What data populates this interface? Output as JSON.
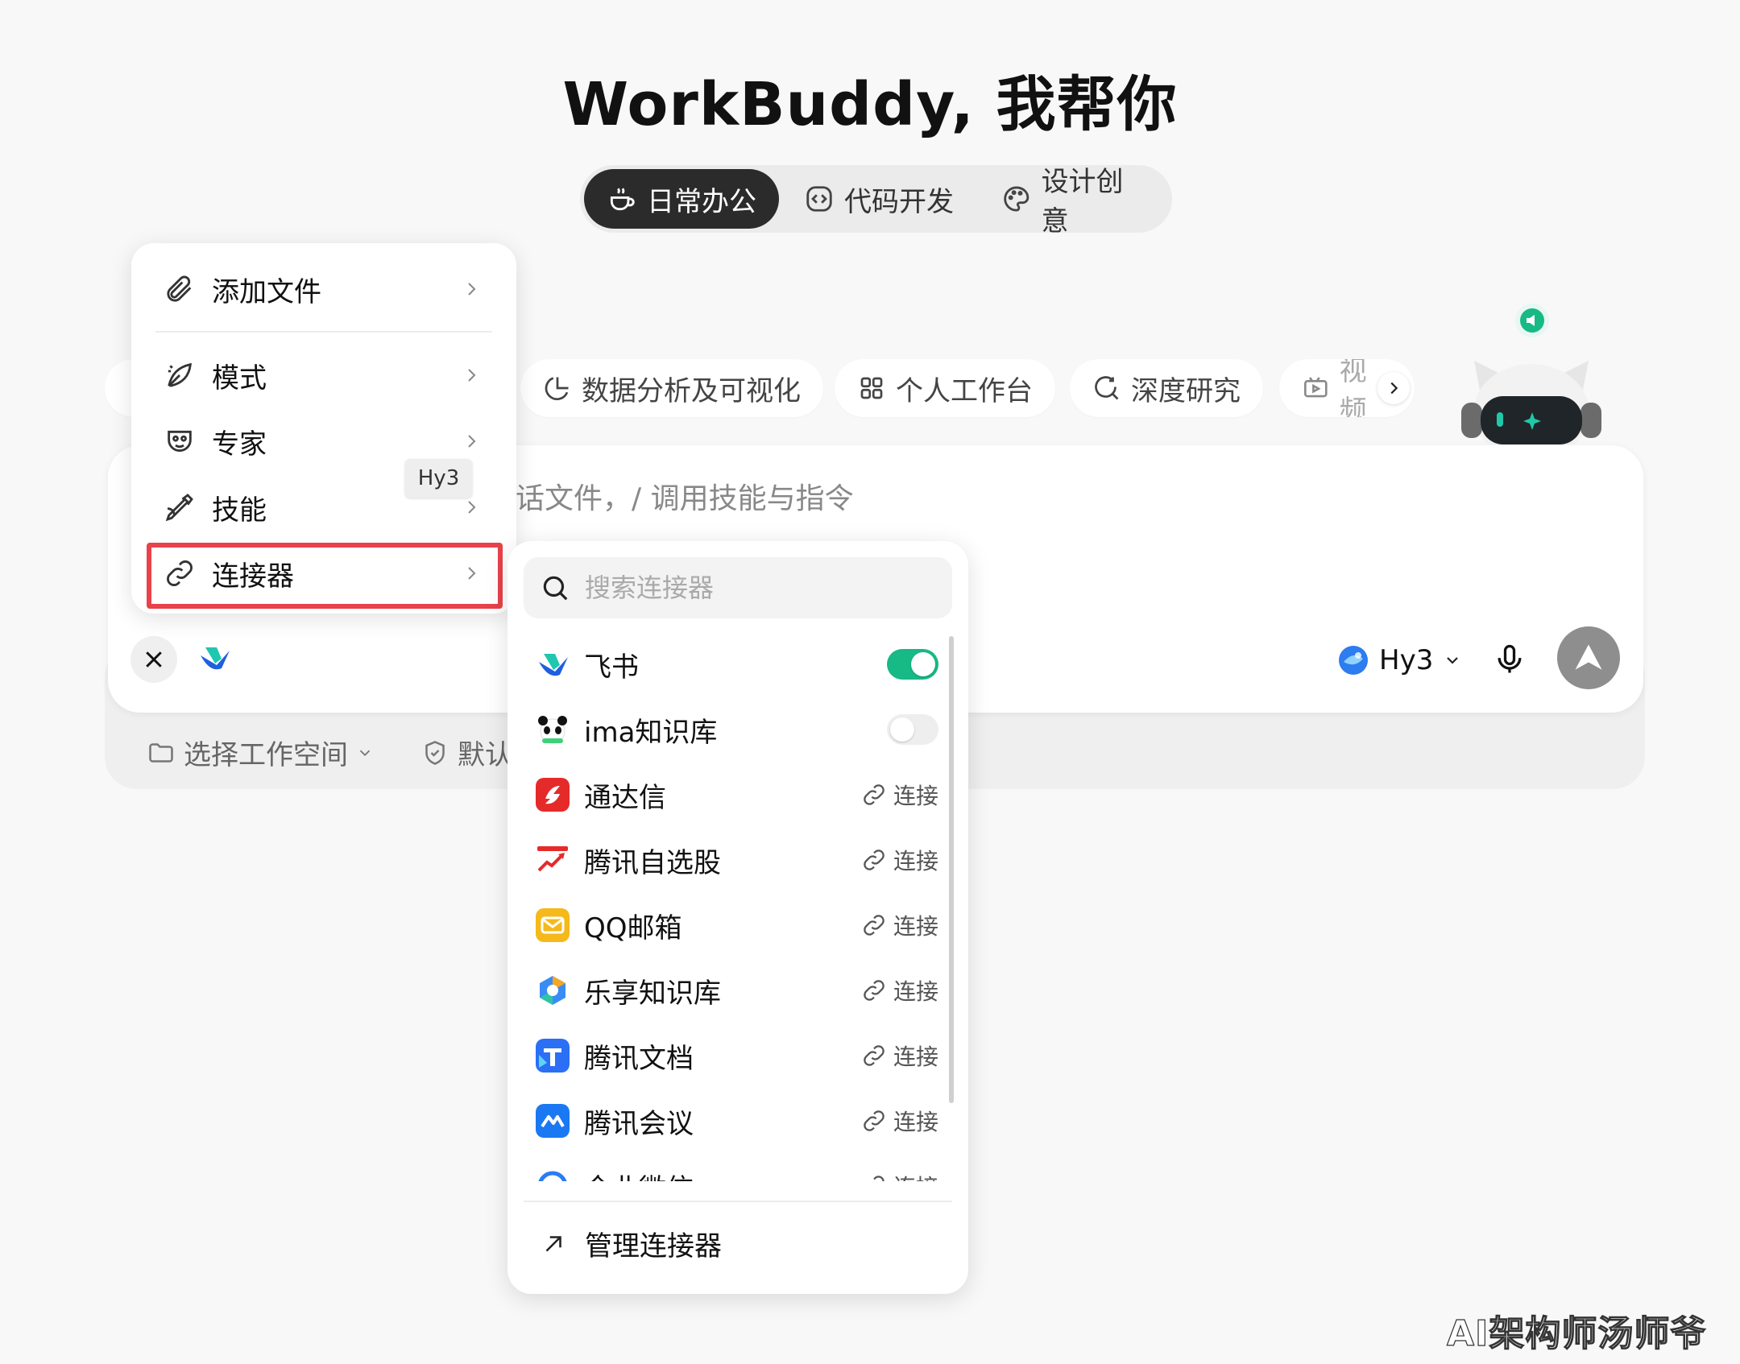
{
  "title": "WorkBuddy, 我帮你",
  "mode_tabs": [
    {
      "label": "日常办公",
      "icon": "coffee-icon",
      "active": true
    },
    {
      "label": "代码开发",
      "icon": "code-icon",
      "active": false
    },
    {
      "label": "设计创意",
      "icon": "palette-icon",
      "active": false
    }
  ],
  "chips": [
    {
      "label": "数据分析及可视化",
      "icon": "pie-chart-icon"
    },
    {
      "label": "个人工作台",
      "icon": "grid-icon"
    },
    {
      "label": "深度研究",
      "icon": "search-refresh-icon"
    },
    {
      "label": "视频",
      "icon": "video-icon"
    }
  ],
  "input": {
    "placeholder": "话文件，/ 调用技能与指令"
  },
  "left_menu": [
    {
      "label": "添加文件",
      "icon": "paperclip-icon"
    },
    {
      "label": "模式",
      "icon": "leaf-icon"
    },
    {
      "label": "专家",
      "icon": "mask-icon"
    },
    {
      "label": "技能",
      "icon": "pen-icon"
    },
    {
      "label": "连接器",
      "icon": "link-icon"
    }
  ],
  "tooltip": "Hy3",
  "model": {
    "label": "Hy3"
  },
  "toolbar": {
    "workspace_label": "选择工作空间",
    "default_label": "默认"
  },
  "connector_panel": {
    "search_placeholder": "搜索连接器",
    "items": [
      {
        "name": "飞书",
        "state": "on"
      },
      {
        "name": "ima知识库",
        "state": "off"
      },
      {
        "name": "通达信",
        "state": "connect",
        "action": "连接"
      },
      {
        "name": "腾讯自选股",
        "state": "connect",
        "action": "连接"
      },
      {
        "name": "QQ邮箱",
        "state": "connect",
        "action": "连接"
      },
      {
        "name": "乐享知识库",
        "state": "connect",
        "action": "连接"
      },
      {
        "name": "腾讯文档",
        "state": "connect",
        "action": "连接"
      },
      {
        "name": "腾讯会议",
        "state": "connect",
        "action": "连接"
      },
      {
        "name": "企业微信",
        "state": "connect",
        "action": "连接"
      }
    ],
    "manage_label": "管理连接器"
  },
  "watermark": "AI架构师汤师爷",
  "colors": {
    "accent_toggle": "#17b985",
    "highlight_border": "#e8424a",
    "active_tab": "#2b2b2b"
  }
}
